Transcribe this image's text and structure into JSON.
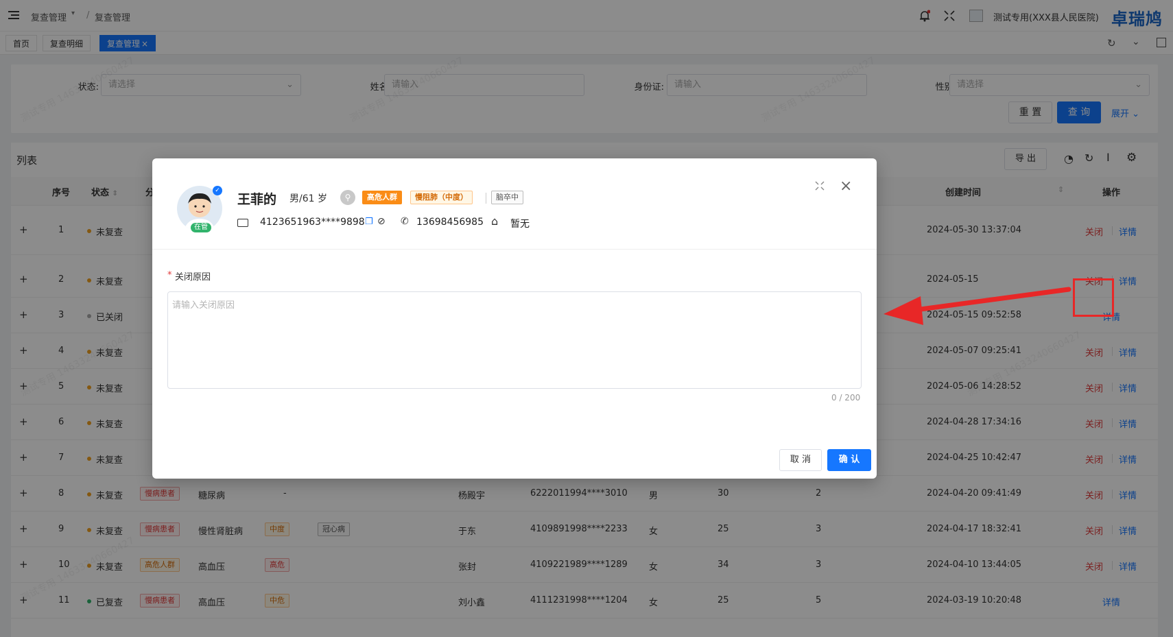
{
  "header": {
    "breadcrumb_root": "复查管理",
    "breadcrumb_sep": "/",
    "breadcrumb_current": "复查管理",
    "user_name": "测试专用(XXX县人民医院)",
    "brand": "卓瑞鸠"
  },
  "tabs": [
    {
      "label": "首页"
    },
    {
      "label": "复查明细"
    },
    {
      "label": "复查管理",
      "close": "×"
    }
  ],
  "filter": {
    "status_label": "状态:",
    "status_placeholder": "请选择",
    "name_label": "姓名:",
    "name_placeholder": "请输入",
    "idcard_label": "身份证:",
    "idcard_placeholder": "请输入",
    "gender_label": "性别:",
    "gender_placeholder": "请选择",
    "reset": "重 置",
    "query": "查 询",
    "expand": "展开"
  },
  "list": {
    "title": "列表",
    "export": "导 出",
    "headers": {
      "index": "序号",
      "status": "状态",
      "created": "创建时间",
      "actions": "操作",
      "partial": "分"
    },
    "close_label": "关闭",
    "detail_label": "详情",
    "rows": [
      {
        "expand": "+",
        "index": "1",
        "status": "未复查",
        "created": "2024-05-30 13:37:04",
        "closable": true
      },
      {
        "expand": "+",
        "index": "2",
        "status": "未复查",
        "created": "2024-05-15",
        "closable": true
      },
      {
        "expand": "+",
        "index": "3",
        "status": "已关闭",
        "created": "2024-05-15 09:52:58",
        "closable": false
      },
      {
        "expand": "+",
        "index": "4",
        "status": "未复查",
        "created": "2024-05-07 09:25:41",
        "closable": true
      },
      {
        "expand": "+",
        "index": "5",
        "status": "未复查",
        "created": "2024-05-06 14:28:52",
        "closable": true
      },
      {
        "expand": "+",
        "index": "6",
        "status": "未复查",
        "created": "2024-04-28 17:34:16",
        "closable": true
      },
      {
        "expand": "+",
        "index": "7",
        "status": "未复查",
        "created": "2024-04-25 10:42:47",
        "closable": true
      },
      {
        "expand": "+",
        "index": "8",
        "status": "未复查",
        "tag": "慢病患者",
        "disease": "糖尿病",
        "level": "-",
        "name": "杨殿宇",
        "idcard": "6222011994****3010",
        "gender": "男",
        "age": "30",
        "count": "2",
        "created": "2024-04-20 09:41:49",
        "closable": true
      },
      {
        "expand": "+",
        "index": "9",
        "status": "未复查",
        "tag": "慢病患者",
        "disease": "慢性肾脏病",
        "level": "中度",
        "extra": "冠心病",
        "name": "于东",
        "idcard": "4109891998****2233",
        "gender": "女",
        "age": "25",
        "count": "3",
        "created": "2024-04-17 18:32:41",
        "closable": true
      },
      {
        "expand": "+",
        "index": "10",
        "status": "未复查",
        "tag": "高危人群",
        "disease": "高血压",
        "level": "高危",
        "name": "张封",
        "idcard": "4109221989****1289",
        "gender": "女",
        "age": "34",
        "count": "3",
        "created": "2024-04-10 13:44:05",
        "closable": true
      },
      {
        "expand": "+",
        "index": "11",
        "status": "已复查",
        "tag": "慢病患者",
        "disease": "高血压",
        "level": "中危",
        "name": "刘小鑫",
        "idcard": "4111231998****1204",
        "gender": "女",
        "age": "25",
        "count": "5",
        "created": "2024-03-19 10:20:48",
        "closable": false
      }
    ]
  },
  "modal": {
    "patient_name": "王菲的",
    "gender_age": "男/61 岁",
    "status_badge": "在管",
    "tag_high_risk": "高危人群",
    "tag_disease": "慢阻肺（中度）",
    "tag_stroke": "脑卒中",
    "id_number": "4123651963****9898",
    "phone": "13698456985",
    "address": "暂无",
    "required_mark": "*",
    "field_label": "关闭原因",
    "textarea_placeholder": "请输入关闭原因",
    "counter": "0 / 200",
    "cancel": "取 消",
    "confirm": "确 认"
  },
  "watermark": "测试专用 14633240660427"
}
